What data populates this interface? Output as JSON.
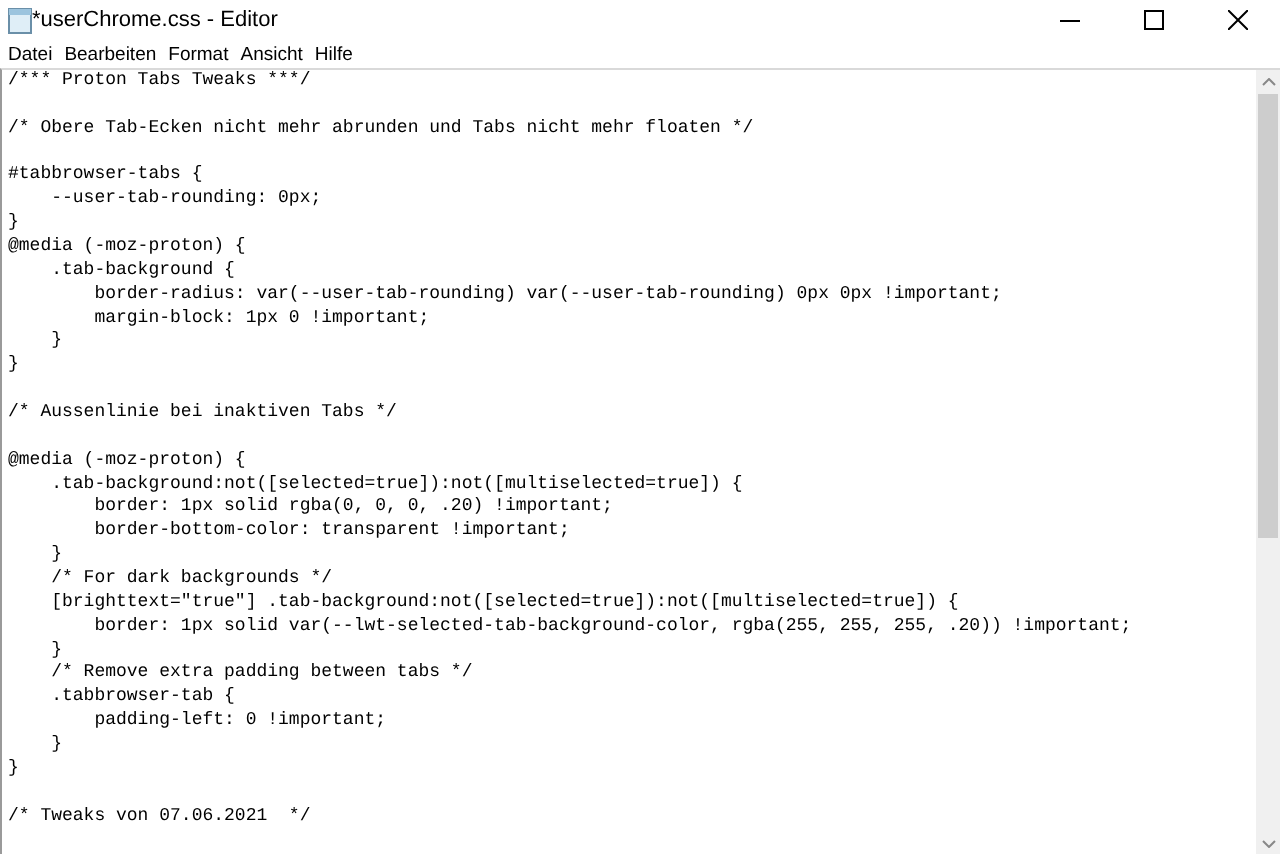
{
  "window": {
    "title": "*userChrome.css - Editor"
  },
  "menu": [
    "Datei",
    "Bearbeiten",
    "Format",
    "Ansicht",
    "Hilfe"
  ],
  "editor": {
    "blocks": [
      [
        "/*** Proton Tabs Tweaks ***/"
      ],
      [
        "/* Obere Tab-Ecken nicht mehr abrunden und Tabs nicht mehr floaten */"
      ],
      [
        "#tabbrowser-tabs {",
        "    --user-tab-rounding: 0px;",
        "}",
        "@media (-moz-proton) {",
        "    .tab-background {",
        "        border-radius: var(--user-tab-rounding) var(--user-tab-rounding) 0px 0px !important;",
        "        margin-block: 1px 0 !important;",
        "    }",
        "}"
      ],
      [
        "/* Aussenlinie bei inaktiven Tabs */"
      ],
      [
        "@media (-moz-proton) {",
        "    .tab-background:not([selected=true]):not([multiselected=true]) {",
        "        border: 1px solid rgba(0, 0, 0, .20) !important;",
        "        border-bottom-color: transparent !important;",
        "    }",
        "    /* For dark backgrounds */",
        "    [brighttext=\"true\"] .tab-background:not([selected=true]):not([multiselected=true]) {",
        "        border: 1px solid var(--lwt-selected-tab-background-color, rgba(255, 255, 255, .20)) !important;",
        "    }",
        "    /* Remove extra padding between tabs */",
        "    .tabbrowser-tab {",
        "        padding-left: 0 !important;",
        "    }",
        "}"
      ],
      [
        "/* Tweaks von 07.06.2021  */"
      ]
    ]
  }
}
